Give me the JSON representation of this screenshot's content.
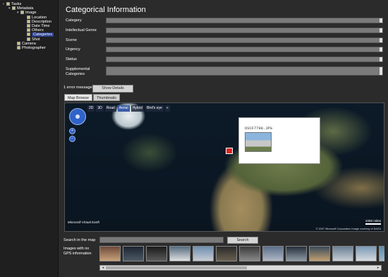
{
  "tree": {
    "items": [
      {
        "label": "Tasks",
        "level": 0,
        "expander": "▪",
        "icon": "tasks-icon"
      },
      {
        "label": "Metadata",
        "level": 1,
        "expander": "▾",
        "icon": "folder-icon"
      },
      {
        "label": "Image",
        "level": 2,
        "expander": "▾",
        "icon": "folder-icon"
      },
      {
        "label": "Location",
        "level": 3,
        "icon": "page-icon"
      },
      {
        "label": "Description",
        "level": 3,
        "icon": "page-icon"
      },
      {
        "label": "Date Time",
        "level": 3,
        "icon": "page-icon"
      },
      {
        "label": "Others",
        "level": 3,
        "icon": "page-icon"
      },
      {
        "label": "Categories",
        "level": 3,
        "icon": "page-icon",
        "selected": true
      },
      {
        "label": "Shot",
        "level": 3,
        "icon": "page-icon"
      },
      {
        "label": "Camera",
        "level": 2,
        "icon": "page-icon"
      },
      {
        "label": "Photographer",
        "level": 2,
        "icon": "page-icon"
      }
    ]
  },
  "form": {
    "title": "Categorical Information",
    "fields": [
      {
        "label": "Category",
        "value": ""
      },
      {
        "label": "Intellectual Genre",
        "value": ""
      },
      {
        "label": "Scene",
        "value": ""
      },
      {
        "label": "Urgency",
        "value": ""
      },
      {
        "label": "Status",
        "value": ""
      },
      {
        "label": "Supplemental Categories",
        "value": ""
      }
    ]
  },
  "errors": {
    "message": "1 error message.",
    "show_details": "Show Details"
  },
  "tabs": [
    {
      "label": "Map Browse",
      "active": true
    },
    {
      "label": "Thumbnails",
      "active": false
    }
  ],
  "map": {
    "toolbar": [
      "2D",
      "3D",
      "Road",
      "Aerial",
      "Hybrid",
      "Bird's eye",
      "«"
    ],
    "active_mode": "Aerial",
    "popup_title": "DSCF7798.JPG",
    "scale_label": "1000 miles",
    "copyright": "© 2007 Microsoft Corporation   Image courtesy of NASA",
    "logo": "Microsoft Virtual Earth"
  },
  "search": {
    "label": "Search in the map",
    "value": "",
    "button": "Search"
  },
  "gps": {
    "label": "Images with no GPS information"
  },
  "thumbnails": [
    {
      "colors": [
        "#6d4a3a",
        "#c9a27a"
      ]
    },
    {
      "colors": [
        "#1d2530",
        "#4d5a66"
      ]
    },
    {
      "colors": [
        "#1a1a1a",
        "#5a5a5a"
      ]
    },
    {
      "colors": [
        "#556b7f",
        "#e0e0e0"
      ]
    },
    {
      "colors": [
        "#6f8fb0",
        "#c7ccd2"
      ]
    },
    {
      "colors": [
        "#2a2a2a",
        "#6a6050"
      ]
    },
    {
      "colors": [
        "#3a3a3a",
        "#8a8a8a"
      ]
    },
    {
      "colors": [
        "#5a6f8a",
        "#b0b8c4"
      ]
    },
    {
      "colors": [
        "#262f3a",
        "#8e9aa6"
      ]
    },
    {
      "colors": [
        "#3a4a5a",
        "#c0a070"
      ]
    },
    {
      "colors": [
        "#6a7f95",
        "#c8ced4"
      ]
    },
    {
      "colors": [
        "#7a9ab6",
        "#d6dadf"
      ]
    },
    {
      "colors": [
        "#5c8aa8",
        "#a0b8c8"
      ]
    }
  ]
}
